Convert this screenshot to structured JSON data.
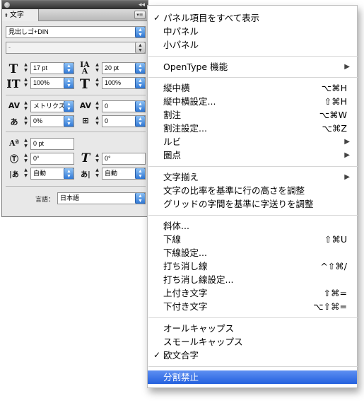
{
  "panel": {
    "tab_label": "文字",
    "font_family": "見出しゴ+DIN",
    "font_style": "-",
    "font_size": "17 pt",
    "leading": "20 pt",
    "vertical_scale": "100%",
    "horizontal_scale": "100%",
    "kerning": "メトリクス",
    "tracking": "0",
    "tsume": "0%",
    "mojikumi": "0",
    "baseline_shift": "0 pt",
    "char_rotation": "0°",
    "skew": "0°",
    "aki_before": "自動",
    "aki_after": "自動",
    "language_label": "言語：",
    "language_value": "日本語"
  },
  "menu": {
    "items": [
      {
        "label": "パネル項目をすべて表示",
        "checked": true
      },
      {
        "label": "中パネル"
      },
      {
        "label": "小パネル"
      },
      {
        "label": "OpenType 機能",
        "submenu": true
      },
      {
        "label": "縦中横",
        "shortcut": "⌥⌘H"
      },
      {
        "label": "縦中横設定...",
        "shortcut": "⇧⌘H"
      },
      {
        "label": "割注",
        "shortcut": "⌥⌘W"
      },
      {
        "label": "割注設定...",
        "shortcut": "⌥⌘Z"
      },
      {
        "label": "ルビ",
        "submenu": true
      },
      {
        "label": "圏点",
        "submenu": true
      },
      {
        "label": "文字揃え",
        "submenu": true
      },
      {
        "label": "文字の比率を基準に行の高さを調整"
      },
      {
        "label": "グリッドの字間を基準に字送りを調整"
      },
      {
        "label": "斜体..."
      },
      {
        "label": "下線",
        "shortcut": "⇧⌘U"
      },
      {
        "label": "下線設定..."
      },
      {
        "label": "打ち消し線",
        "shortcut": "^⇧⌘/"
      },
      {
        "label": "打ち消し線設定..."
      },
      {
        "label": "上付き文字",
        "shortcut": "⇧⌘="
      },
      {
        "label": "下付き文字",
        "shortcut": "⌥⇧⌘="
      },
      {
        "label": "オールキャップス"
      },
      {
        "label": "スモールキャップス"
      },
      {
        "label": "欧文合字",
        "checked": true
      },
      {
        "label": "分割禁止",
        "selected": true
      }
    ],
    "check_glyph": "✓",
    "submenu_glyph": "▶"
  }
}
